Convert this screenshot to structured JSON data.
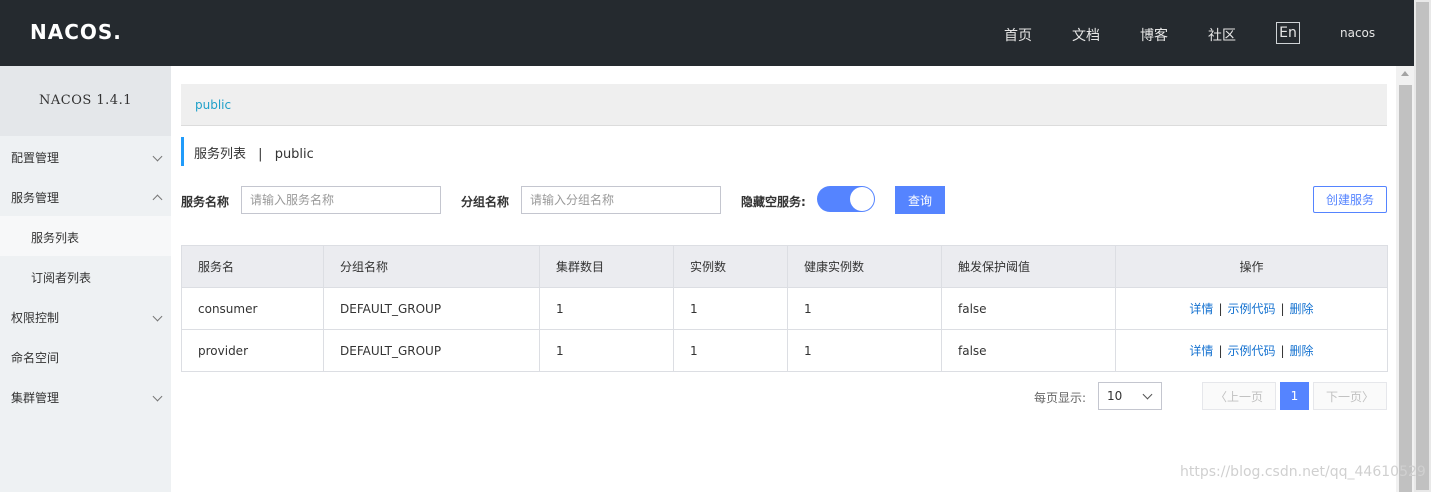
{
  "header": {
    "logo": "NACOS.",
    "nav": [
      "首页",
      "文档",
      "博客",
      "社区"
    ],
    "lang": "En",
    "user": "nacos"
  },
  "sidebar": {
    "version": "NACOS 1.4.1",
    "items": [
      {
        "label": "配置管理",
        "chevron": "down"
      },
      {
        "label": "服务管理",
        "chevron": "up"
      },
      {
        "label": "服务列表",
        "sub": true,
        "active": true
      },
      {
        "label": "订阅者列表",
        "sub": true
      },
      {
        "label": "权限控制",
        "chevron": "down"
      },
      {
        "label": "命名空间"
      },
      {
        "label": "集群管理",
        "chevron": "down"
      }
    ]
  },
  "namespace": {
    "current": "public"
  },
  "page": {
    "title": "服务列表",
    "separator": "|",
    "namespace": "public"
  },
  "filters": {
    "service_label": "服务名称",
    "service_placeholder": "请输入服务名称",
    "group_label": "分组名称",
    "group_placeholder": "请输入分组名称",
    "hide_empty_label": "隐藏空服务:",
    "hide_empty_on": true,
    "query_button": "查询",
    "create_button": "创建服务"
  },
  "table": {
    "headers": [
      "服务名",
      "分组名称",
      "集群数目",
      "实例数",
      "健康实例数",
      "触发保护阈值",
      "操作"
    ],
    "rows": [
      {
        "name": "consumer",
        "group": "DEFAULT_GROUP",
        "clusters": "1",
        "instances": "1",
        "healthy": "1",
        "threshold": "false"
      },
      {
        "name": "provider",
        "group": "DEFAULT_GROUP",
        "clusters": "1",
        "instances": "1",
        "healthy": "1",
        "threshold": "false"
      }
    ],
    "actions": {
      "detail": "详情",
      "sample": "示例代码",
      "delete": "删除",
      "sep": "|"
    }
  },
  "pagination": {
    "per_page_label": "每页显示:",
    "per_page_value": "10",
    "prev": "上一页",
    "next": "下一页",
    "current": "1"
  },
  "watermark": "https://blog.csdn.net/qq_44610529",
  "colors": {
    "header_bg": "#252a2f",
    "primary": "#5584ff",
    "link": "#1572d0",
    "accent_bar": "#209bfa"
  }
}
